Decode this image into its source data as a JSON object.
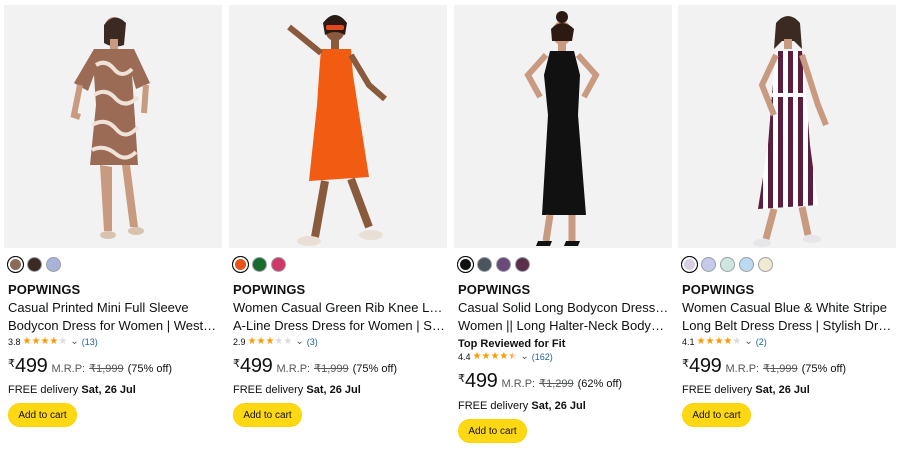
{
  "products": [
    {
      "brand": "POPWINGS",
      "title_line1": "Casual Printed Mini Full Sleeve",
      "title_line2": "Bodycon Dress for Women | Western…",
      "rating": "3.8",
      "stars_value": 3.8,
      "review_count": "(13)",
      "currency": "₹",
      "price": "499",
      "mrp_label": "M.R.P:",
      "mrp": "₹1,999",
      "discount": "(75% off)",
      "delivery_prefix": "FREE delivery",
      "delivery_date": "Sat, 26 Jul",
      "cart_label": "Add to cart",
      "swatches": [
        "#8a6a5a",
        "#3b2a22",
        "#a9b3d8"
      ],
      "selected_swatch": 0,
      "dress_color": "#9b6b55"
    },
    {
      "brand": "POPWINGS",
      "title_line1": "Women Casual Green Rib Knee Length",
      "title_line2": "A-Line Dress Dress for Women | Styli…",
      "rating": "2.9",
      "stars_value": 2.9,
      "review_count": "(3)",
      "currency": "₹",
      "price": "499",
      "mrp_label": "M.R.P:",
      "mrp": "₹1,999",
      "discount": "(75% off)",
      "delivery_prefix": "FREE delivery",
      "delivery_date": "Sat, 26 Jul",
      "cart_label": "Add to cart",
      "swatches": [
        "#e8521b",
        "#1a6b2e",
        "#d0386a"
      ],
      "selected_swatch": 0,
      "dress_color": "#f25c12"
    },
    {
      "brand": "POPWINGS",
      "title_line1": "Casual Solid Long Bodycon Dress for",
      "title_line2": "Women || Long Halter-Neck Bodyco…",
      "badge": "Top Reviewed for Fit",
      "rating": "4.4",
      "stars_value": 4.4,
      "review_count": "(162)",
      "currency": "₹",
      "price": "499",
      "mrp_label": "M.R.P:",
      "mrp": "₹1,299",
      "discount": "(62% off)",
      "delivery_prefix": "FREE delivery",
      "delivery_date": "Sat, 26 Jul",
      "cart_label": "Add to cart",
      "swatches": [
        "#111111",
        "#4a5560",
        "#6a4a7a",
        "#5a2f4a"
      ],
      "selected_swatch": 0,
      "dress_color": "#111111"
    },
    {
      "brand": "POPWINGS",
      "title_line1": "Women Casual Blue & White Stripe",
      "title_line2": "Long Belt Dress Dress | Stylish Dress…",
      "rating": "4.1",
      "stars_value": 4.1,
      "review_count": "(2)",
      "currency": "₹",
      "price": "499",
      "mrp_label": "M.R.P:",
      "mrp": "₹1,999",
      "discount": "(75% off)",
      "delivery_prefix": "FREE delivery",
      "delivery_date": "Sat, 26 Jul",
      "cart_label": "Add to cart",
      "swatches": [
        "#d9cfe3",
        "#c7c9e8",
        "#cfe6e0",
        "#bcd9ef",
        "#f1ead2"
      ],
      "selected_swatch": 0,
      "dress_color": "#5a1e3e"
    }
  ],
  "icons": {
    "star": "star-icon",
    "chevron": "chevron-down-icon"
  }
}
